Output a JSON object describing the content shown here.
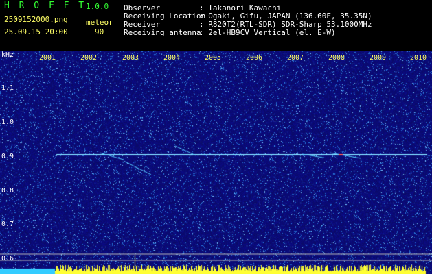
{
  "header": {
    "app_title": "H R O F F T",
    "version": "1.0.0",
    "filename": "2509152000.png",
    "mode_label": "meteor",
    "datetime": "25.09.15 20:00",
    "count": "90",
    "info": [
      {
        "label": "Observer",
        "value": ": Takanori Kawachi"
      },
      {
        "label": "Receiving Location",
        "value": ": Ogaki, Gifu, JAPAN (136.60E, 35.35N)"
      },
      {
        "label": "Receiver",
        "value": ": R820T2(RTL-SDR) SDR-Sharp 53.1000MHz"
      },
      {
        "label": "Receiving antenna",
        "value": ": 2el-HB9CV Vertical (el. E-W)"
      }
    ]
  },
  "axis": {
    "unit": "kHz",
    "ticks": [
      "1.1",
      "1.0",
      "0.9",
      "0.8",
      "0.7",
      "0.6"
    ],
    "years": [
      "2001",
      "2002",
      "2003",
      "2004",
      "2005",
      "2006",
      "2007",
      "2008",
      "2009",
      "2010"
    ]
  },
  "colors": {
    "background_plot": "#0a0a66",
    "carrier": "#7fd8ff",
    "header_green": "#33ff33",
    "header_yellow": "#ffff66"
  }
}
